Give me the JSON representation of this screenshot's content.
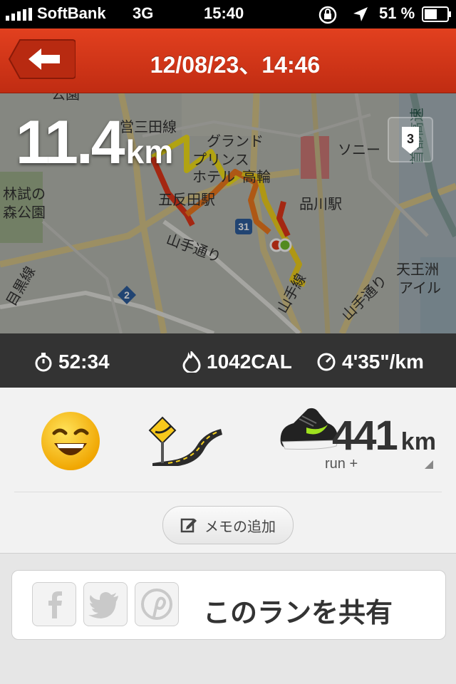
{
  "status": {
    "carrier": "SoftBank",
    "network": "3G",
    "time": "15:40",
    "battery": "51 %"
  },
  "nav": {
    "title": "12/08/23、14:46",
    "back_icon": "back-arrow-icon"
  },
  "map": {
    "distance_value": "11.4",
    "distance_unit": "km",
    "lap_count": "3",
    "labels": {
      "sanda": "営三田線",
      "grand": "グランド",
      "prince": "プリンス",
      "hotel": "ホテル",
      "takanawa": "高輪",
      "gotanda": "五反田駅",
      "shinagawa": "品川駅",
      "sony": "ソニー",
      "forest1": "林試の",
      "forest2": "森公園",
      "meguro": "目黒線",
      "yamate1": "山手通り",
      "yamate2": "山手線",
      "yamate3": "山手通り",
      "tennozu1": "天王洲",
      "tennozu2": "アイル",
      "park": "公園",
      "expressway": "首都高速",
      "route31": "31",
      "route2": "2"
    }
  },
  "stats": {
    "duration": "52:34",
    "calories": "1042CAL",
    "pace": "4'35\"/km"
  },
  "run_info": {
    "mood_icon": "happy-face-icon",
    "terrain_icon": "road-terrain-icon",
    "shoe_distance": "441",
    "shoe_unit": "km",
    "shoe_name": "run +",
    "memo_label": "メモの追加"
  },
  "share": {
    "label": "このランを共有",
    "icons": [
      "facebook-icon",
      "twitter-icon",
      "pinterest-icon"
    ]
  },
  "colors": {
    "nav_red": "#d4361a",
    "route_yellow": "#f5e21a",
    "route_red": "#e02a12"
  }
}
